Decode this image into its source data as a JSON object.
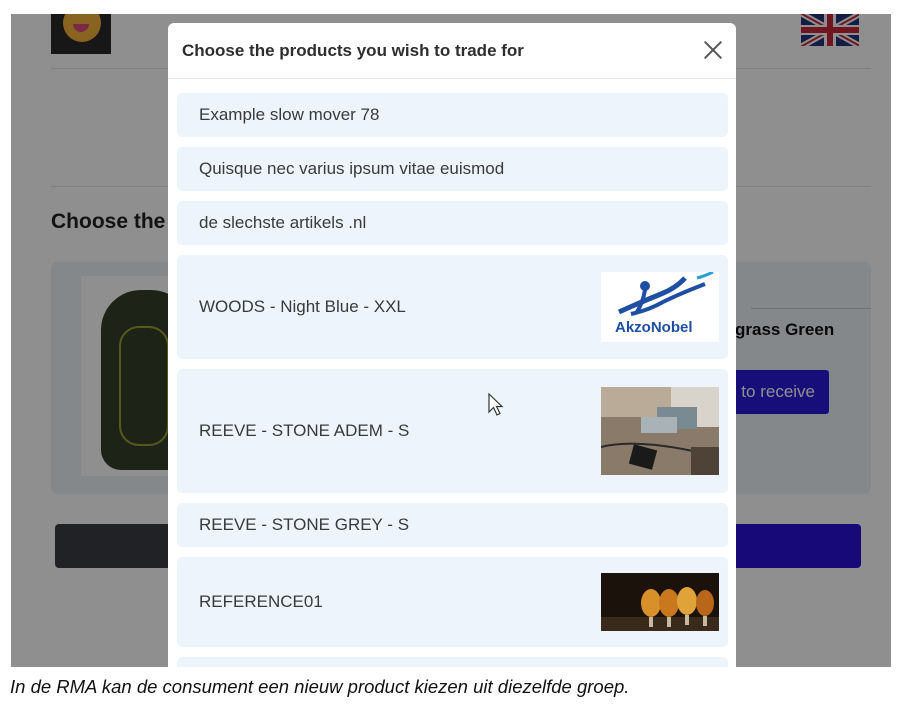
{
  "background_page": {
    "section_title": "Choose the",
    "product_name": "grass Green",
    "receive_button_label": "to receive"
  },
  "modal": {
    "title": "Choose the products you wish to trade for",
    "options": [
      {
        "label": "Example slow mover 78"
      },
      {
        "label": "Quisque nec varius ipsum vitae euismod"
      },
      {
        "label": "de slechste artikels .nl"
      },
      {
        "label": "WOODS - Night Blue - XXL",
        "thumbnail_text": "AkzoNobel"
      },
      {
        "label": "REEVE - STONE ADEM - S"
      },
      {
        "label": "REEVE - STONE GREY - S"
      },
      {
        "label": "REFERENCE01"
      }
    ]
  },
  "caption": "In de RMA kan de consument een nieuw product kiezen uit diezelfde groep.",
  "colors": {
    "accent_button": "#2b19d8",
    "option_background": "#eef4fc",
    "akzonobel_blue": "#1e4fa3"
  },
  "icons": [
    "close-icon",
    "mouse-cursor-icon",
    "uk-flag-icon"
  ]
}
